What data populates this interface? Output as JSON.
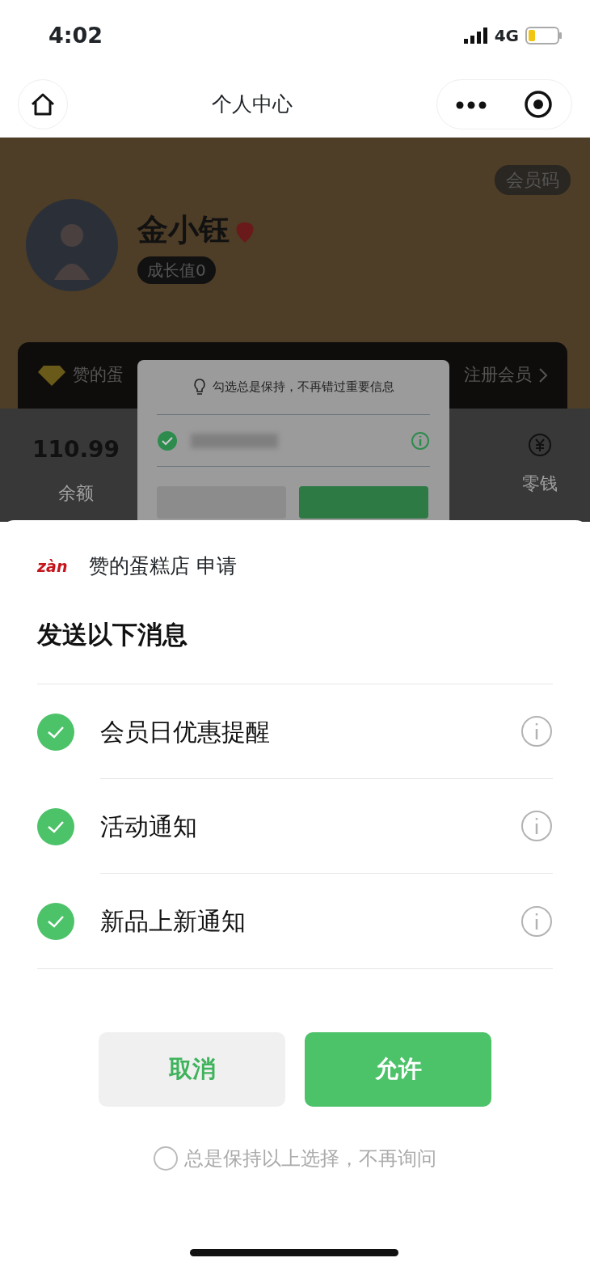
{
  "status_bar": {
    "time": "4:02",
    "network": "4G"
  },
  "nav": {
    "title": "个人中心"
  },
  "profile": {
    "name": "金小钰",
    "growth": "成长值0",
    "member_code": "会员码"
  },
  "member_card": {
    "shop": "赞的蛋",
    "action": "注册会员"
  },
  "stats": [
    {
      "value": "110.99",
      "label": "余额",
      "kind": "number"
    },
    {
      "label": "零钱",
      "kind": "icon"
    }
  ],
  "inner_dialog": {
    "tip": "勾选总是保持，不再错过重要信息",
    "checked": true
  },
  "sheet": {
    "logo_text": "zàn",
    "applicant": "赞的蛋糕店 申请",
    "heading": "发送以下消息",
    "items": [
      {
        "label": "会员日优惠提醒",
        "checked": true
      },
      {
        "label": "活动通知",
        "checked": true
      },
      {
        "label": "新品上新通知",
        "checked": true
      }
    ],
    "buttons": [
      {
        "label": "取消",
        "kind": "secondary"
      },
      {
        "label": "允许",
        "kind": "primary"
      }
    ],
    "always_keep": {
      "label": "总是保持以上选择，不再询问",
      "checked": false
    }
  }
}
